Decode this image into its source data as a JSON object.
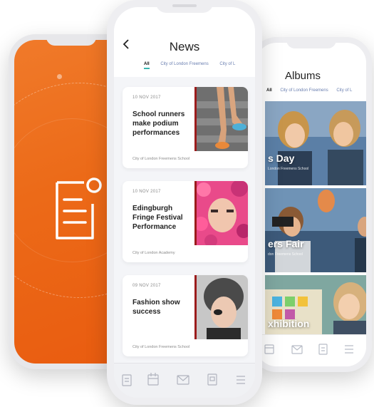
{
  "news": {
    "title": "News",
    "back_icon": "chevron-left-icon",
    "tabs": [
      {
        "label": "All",
        "active": true
      },
      {
        "label": "City of London Freemens",
        "active": false
      },
      {
        "label": "City of L",
        "active": false
      }
    ],
    "cards": [
      {
        "date": "10 NOV 2017",
        "headline": "School runners make podium performances",
        "source": "City of London Freemens School"
      },
      {
        "date": "10 NOV 2017",
        "headline": "Edingburgh Fringe Festival Performance",
        "source": "City of London Academy"
      },
      {
        "date": "09 NOV 2017",
        "headline": "Fashion show success",
        "source": "City of London Freemens School"
      }
    ],
    "tabbar_icons": [
      "news-icon",
      "calendar-icon",
      "mail-icon",
      "document-icon",
      "menu-icon"
    ]
  },
  "albums": {
    "title": "Albums",
    "tabs": [
      {
        "label": "All",
        "active": true
      },
      {
        "label": "City of London Freemens",
        "active": false
      },
      {
        "label": "City of L",
        "active": false
      }
    ],
    "items": [
      {
        "label": "s Day",
        "sub": "London Freemens School"
      },
      {
        "label": "ers Fair",
        "sub": "don Freemens School"
      },
      {
        "label": "xhibition",
        "sub": ""
      }
    ]
  },
  "splash": {
    "logo_icon": "notification-document-icon",
    "accent": "#ec6a18"
  }
}
